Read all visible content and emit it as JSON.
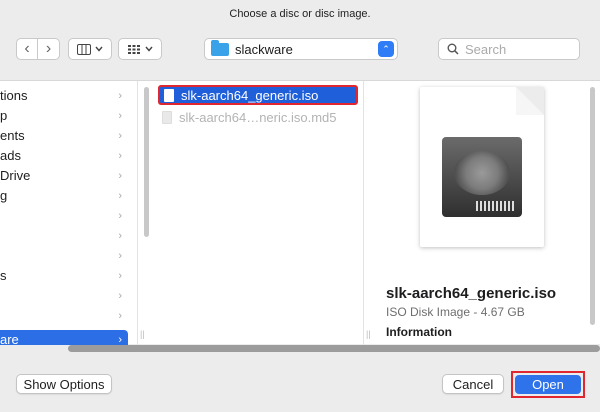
{
  "dialog": {
    "title": "Choose a disc or disc image."
  },
  "toolbar": {
    "back_glyph": "‹",
    "forward_glyph": "›",
    "location": "slackware",
    "search_placeholder": "Search"
  },
  "sidebar": {
    "items": [
      {
        "label": "tions"
      },
      {
        "label": "p"
      },
      {
        "label": "ents"
      },
      {
        "label": "ads"
      },
      {
        "label": "Drive"
      },
      {
        "label": "g"
      },
      {
        "label": ""
      },
      {
        "label": ""
      },
      {
        "label": ""
      },
      {
        "label": "s"
      },
      {
        "label": ""
      },
      {
        "label": ""
      },
      {
        "label": "are"
      }
    ]
  },
  "files": [
    {
      "name": "slk-aarch64_generic.iso"
    },
    {
      "name": "slk-aarch64…neric.iso.md5"
    }
  ],
  "preview": {
    "name": "slk-aarch64_generic.iso",
    "kind": "ISO Disk Image - 4.67 GB",
    "section": "Information"
  },
  "buttons": {
    "show_options": "Show Options",
    "cancel": "Cancel",
    "open": "Open"
  },
  "icons": {
    "back": "chevron-left-icon",
    "forward": "chevron-right-icon",
    "view": "columns-view-icon",
    "group": "grid-group-icon",
    "folder": "folder-icon",
    "search": "search-icon",
    "file": "document-icon",
    "drive": "hard-drive-icon"
  },
  "colors": {
    "selection": "#1f5fd9",
    "primary_button": "#2f73ea",
    "highlight_outline": "#e0262f"
  }
}
